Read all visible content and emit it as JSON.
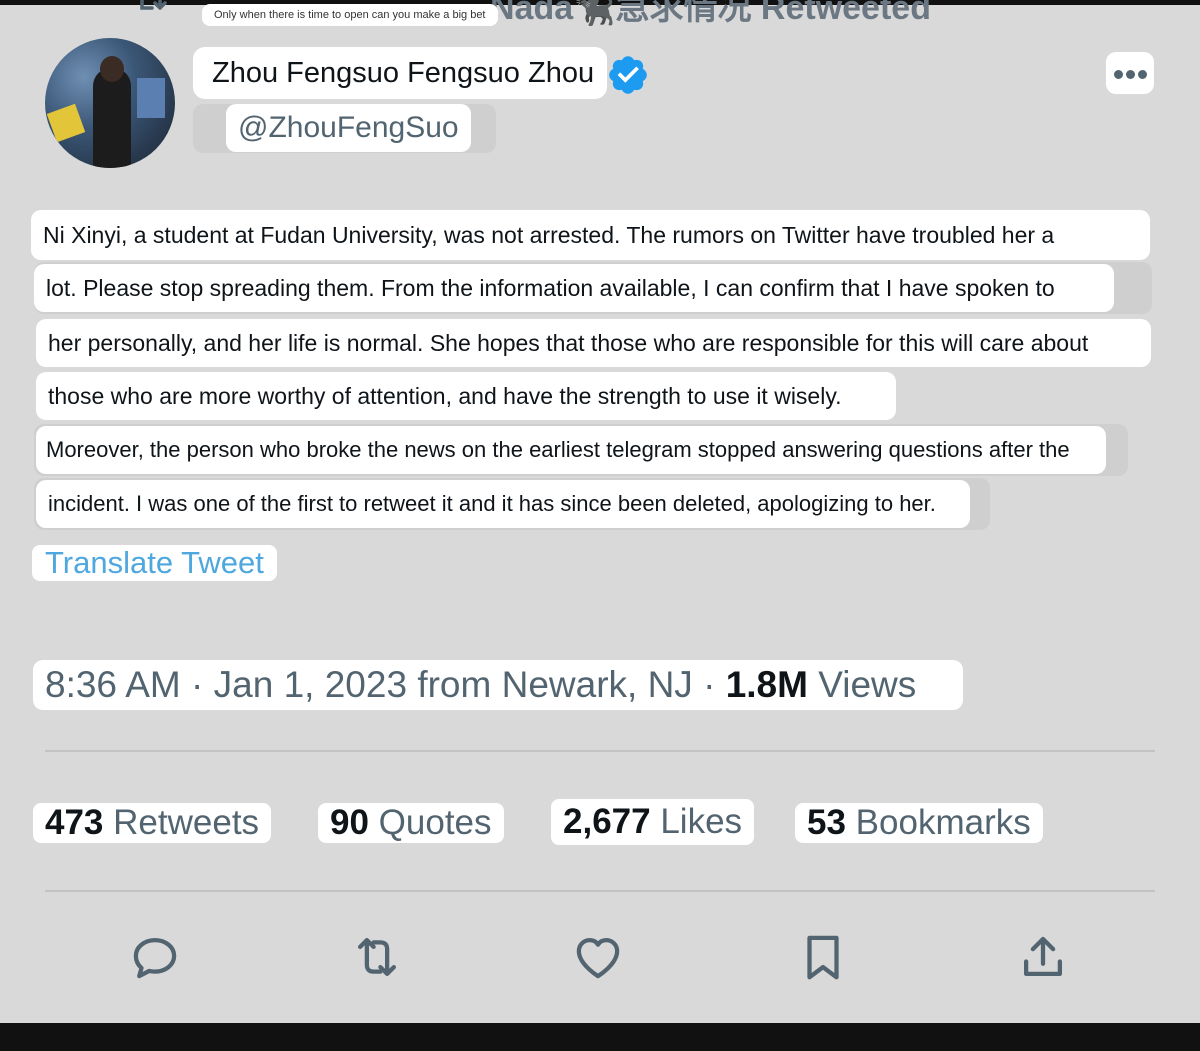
{
  "header": {
    "caption": "Only when there is time to open can you make a big bet",
    "retweeted_by": "Nada🐈‍⬛急求情况 Retweeted"
  },
  "tweet": {
    "display_name": "Zhou Fengsuo Fengsuo Zhou",
    "handle": "@ZhouFengSuo",
    "text_lines": [
      "Ni Xinyi, a student at Fudan University, was not arrested. The rumors on Twitter have troubled her a",
      "lot. Please stop spreading them. From the information available, I can confirm that I have spoken to",
      "her personally, and her life is normal. She hopes that those who are responsible for this will care about",
      "those who are more worthy of attention, and have the strength to use it wisely.",
      "Moreover, the person who broke the news on the earliest telegram stopped answering questions after the",
      "incident. I was one of the first to retweet it and it has since been deleted, apologizing to her."
    ],
    "translate_label": "Translate Tweet",
    "time": "8:36 AM",
    "date": "Jan 1, 2023",
    "location": "from Newark, NJ",
    "views_count": "1.8M",
    "views_label": "Views"
  },
  "stats": {
    "retweets": {
      "count": "473",
      "label": "Retweets"
    },
    "quotes": {
      "count": "90",
      "label": "Quotes"
    },
    "likes": {
      "count": "2,677",
      "label": "Likes"
    },
    "bookmarks": {
      "count": "53",
      "label": "Bookmarks"
    }
  },
  "icons": {
    "header": [
      "retweet-icon"
    ],
    "profile": [
      "avatar",
      "verified-badge-icon",
      "more-options-icon"
    ],
    "actions": [
      "reply-icon",
      "retweet-icon",
      "like-icon",
      "bookmark-icon",
      "share-icon"
    ]
  },
  "colors": {
    "background": "#d9d9d9",
    "highlight": "#ffffff",
    "link": "#4ea7de",
    "verified": "#1d9bf0",
    "secondary_text": "#536471"
  }
}
